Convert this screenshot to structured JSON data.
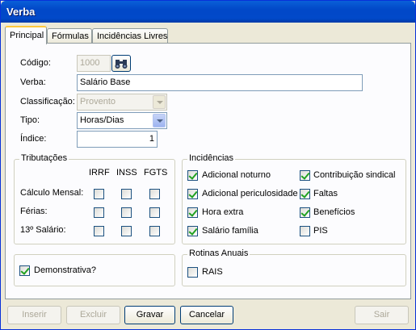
{
  "window": {
    "title": "Verba"
  },
  "tabs": [
    {
      "label": "Principal"
    },
    {
      "label": "Fórmulas"
    },
    {
      "label": "Incidências Livres"
    }
  ],
  "form": {
    "codigo_label": "Código:",
    "codigo_value": "1000",
    "verba_label": "Verba:",
    "verba_value": "Salário Base",
    "classificacao_label": "Classificação:",
    "classificacao_value": "Provento",
    "tipo_label": "Tipo:",
    "tipo_value": "Horas/Dias",
    "indice_label": "Índice:",
    "indice_value": "1"
  },
  "tributacoes": {
    "title": "Tributações",
    "columns": [
      "IRRF",
      "INSS",
      "FGTS"
    ],
    "rows": [
      {
        "label": "Cálculo Mensal:",
        "checks": [
          false,
          false,
          false
        ]
      },
      {
        "label": "Férias:",
        "checks": [
          false,
          false,
          false
        ]
      },
      {
        "label": "13º Salário:",
        "checks": [
          false,
          false,
          false
        ]
      }
    ]
  },
  "incidencias": {
    "title": "Incidências",
    "items": [
      {
        "label": "Adicional noturno",
        "checked": true
      },
      {
        "label": "Contribuição sindical",
        "checked": true
      },
      {
        "label": "Adicional periculosidade",
        "checked": true
      },
      {
        "label": "Faltas",
        "checked": true
      },
      {
        "label": "Hora extra",
        "checked": true
      },
      {
        "label": "Benefícios",
        "checked": true
      },
      {
        "label": "Salário família",
        "checked": true
      },
      {
        "label": "PIS",
        "checked": false
      }
    ]
  },
  "demonstrativa": {
    "label": "Demonstrativa?",
    "checked": true
  },
  "rotinas": {
    "title": "Rotinas Anuais",
    "rais_label": "RAIS",
    "rais_checked": false
  },
  "buttons": {
    "inserir": "Inserir",
    "excluir": "Excluir",
    "gravar": "Gravar",
    "cancelar": "Cancelar",
    "sair": "Sair"
  },
  "icons": {
    "find": "binoculars-icon"
  }
}
